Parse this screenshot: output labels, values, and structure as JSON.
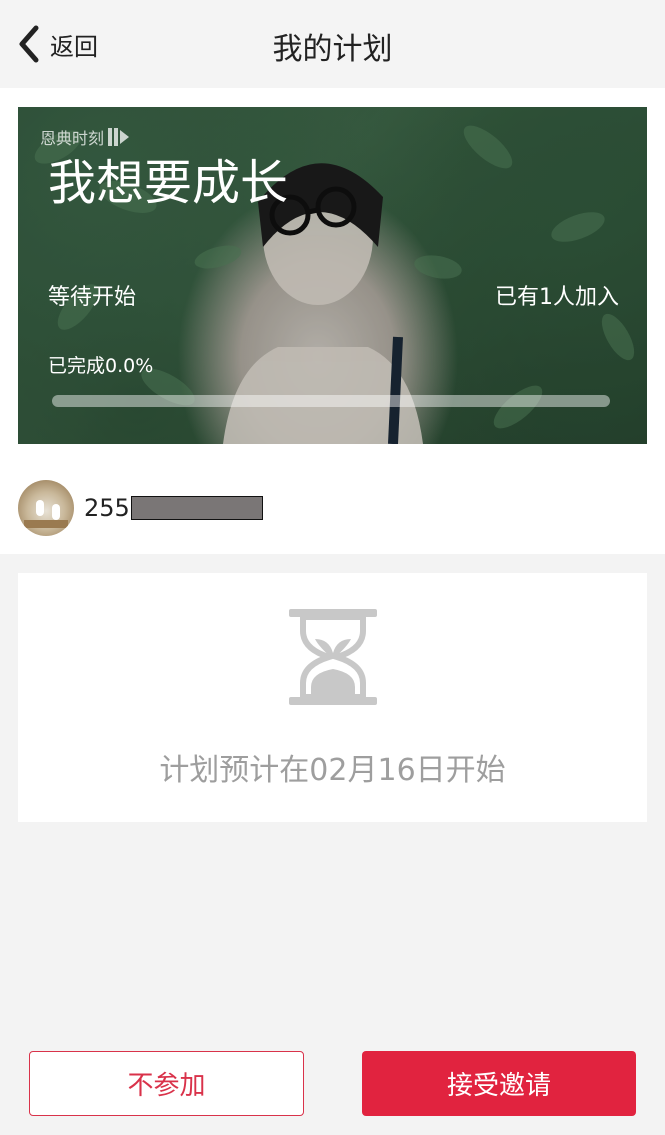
{
  "header": {
    "back_label": "返回",
    "title": "我的计划"
  },
  "banner": {
    "brand": "恩典时刻",
    "plan_name": "我想要成长",
    "status": "等待开始",
    "joined": "已有1人加入",
    "progress_label": "已完成0.0%",
    "progress_fraction": 0.0
  },
  "user": {
    "name_prefix": "255"
  },
  "info": {
    "start_text": "计划预计在02月16日开始"
  },
  "actions": {
    "decline_label": "不参加",
    "accept_label": "接受邀请"
  },
  "colors": {
    "accent": "#e1233f",
    "background": "#f3f3f3"
  },
  "icons": {
    "back": "chevron-left-icon",
    "hourglass": "hourglass-icon"
  }
}
